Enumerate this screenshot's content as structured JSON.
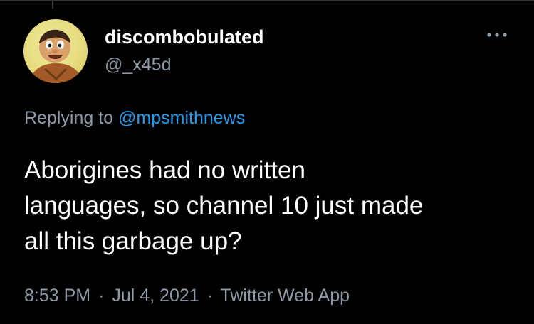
{
  "tweet": {
    "display_name": "discombobulated",
    "handle": "@_x45d",
    "replying_prefix": "Replying to",
    "replying_to": "@mpsmithnews",
    "text_lines": [
      "Aborigines had no written",
      "languages, so channel 10 just made",
      "all this garbage up?"
    ],
    "time": "8:53 PM",
    "separator": "·",
    "date": "Jul 4, 2021",
    "source": "Twitter Web App"
  },
  "icons": {
    "more": "more-horizontal-icon",
    "avatar": "cartoon-character-avatar"
  },
  "colors": {
    "background": "#000000",
    "primary_text": "#ffffff",
    "secondary_text": "#8b98a5",
    "link": "#1d9bf0"
  }
}
